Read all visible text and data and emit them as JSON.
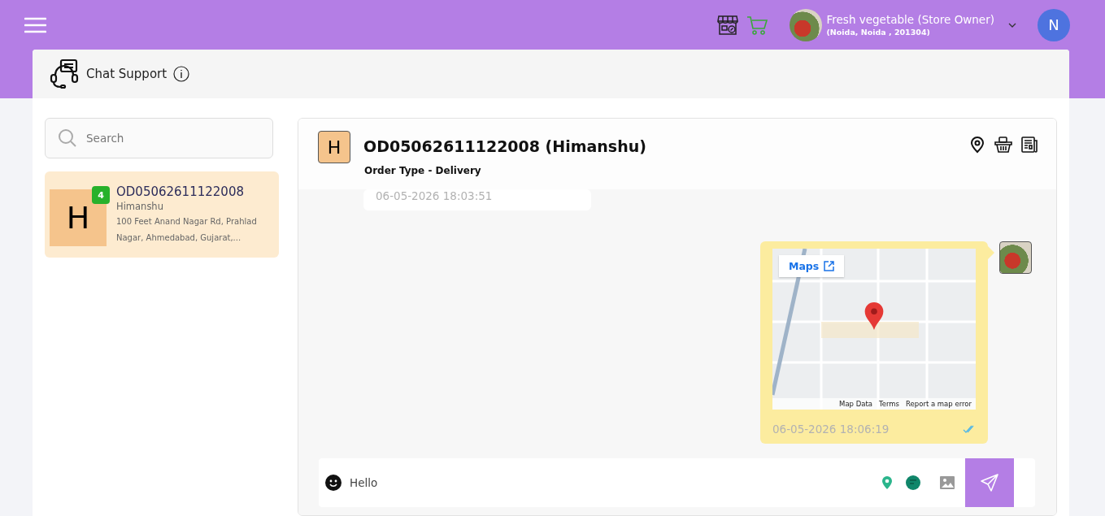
{
  "top_bar": {
    "store_name": "Fresh vegetable (Store Owner)",
    "store_address": "(Noida, Noida , 201304)",
    "user_initial": "N"
  },
  "page": {
    "title": "Chat Support"
  },
  "search": {
    "placeholder": "Search"
  },
  "conversations": [
    {
      "initial": "H",
      "unread": "4",
      "order_id": "OD05062611122008",
      "customer": "Himanshu",
      "address": "100 Feet Anand Nagar Rd, Prahlad Nagar, Ahmedabad, Gujarat,...",
      "selected": true
    }
  ],
  "chat": {
    "initial": "H",
    "title": "OD05062611122008 (Himanshu)",
    "subtitle": "Order Type - Delivery",
    "messages": [
      {
        "kind": "text",
        "outgoing": false,
        "time": "06-05-2026 18:03:51"
      },
      {
        "kind": "map",
        "outgoing": true,
        "time": "06-05-2026 18:06:19",
        "read": true,
        "map_link": "Maps",
        "map_footer": [
          "Map Data",
          "Terms",
          "Report a map error"
        ]
      }
    ],
    "composer": {
      "value": "Hello"
    }
  }
}
